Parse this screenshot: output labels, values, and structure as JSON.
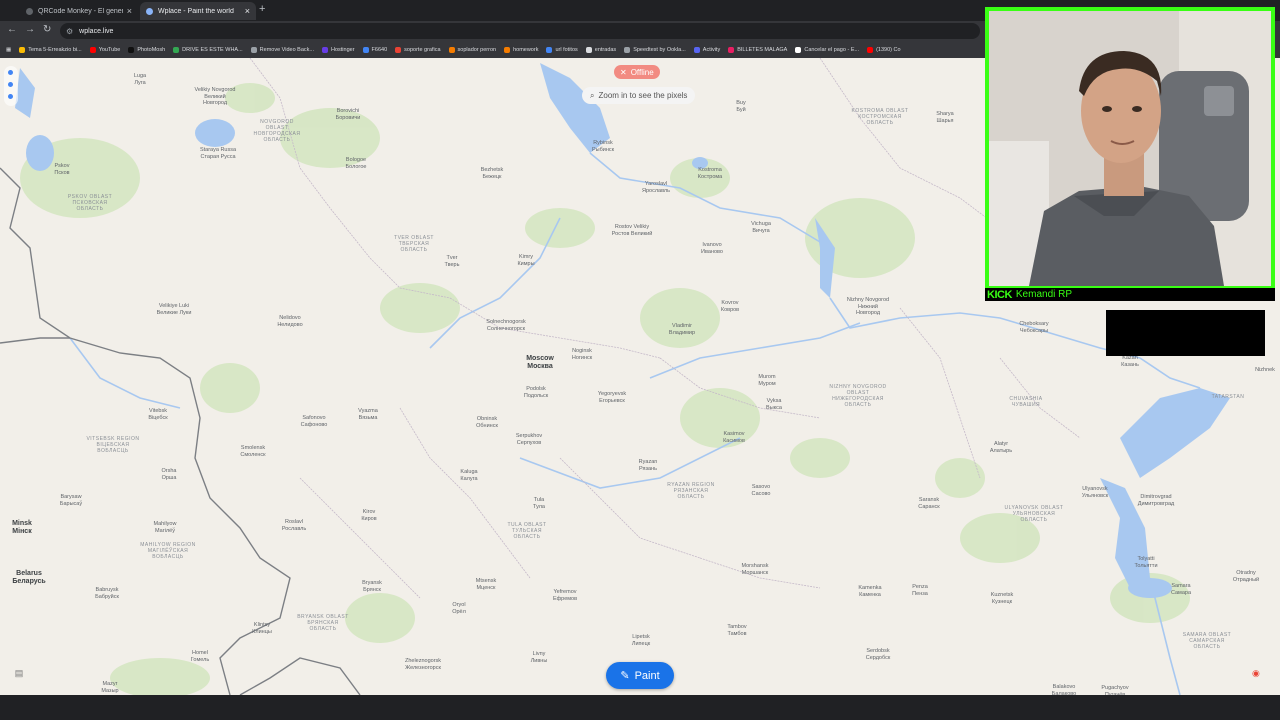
{
  "browser": {
    "tabs": [
      {
        "label": "QRCode Monkey - El generad...",
        "active": false
      },
      {
        "label": "Wplace - Paint the world",
        "active": true
      }
    ],
    "url": "wplace.live",
    "bookmarks": [
      "Tema 5-Erreakzio bi...",
      "YouTube",
      "PhotoMosh",
      "DRIVE ES ESTE WHA...",
      "Remove Video Back...",
      "Hostinger",
      "F6640",
      "soporte grafica",
      "soplador perron",
      "homework",
      "url fotitos",
      "entradas",
      "Speedtest by Ookla...",
      "Activity",
      "BILLETES MALAGA",
      "Cancelar el pago - E...",
      "(1390) Co"
    ]
  },
  "map": {
    "status_badge": "Offline",
    "zoom_hint": "Zoom in to see the pixels",
    "paint_button": "Paint",
    "cities": {
      "luga": "Luga\nЛуга",
      "velikiy_novgorod": "Velikiy Novgorod\nВеликий\nНовгород",
      "borovichi": "Borovichi\nБоровичи",
      "pskov": "Pskov\nПсков",
      "staraya_russa": "Staraya Russa\nСтарая Русса",
      "bologoe": "Bologoe\nБологое",
      "bezhetsk": "Bezhetsk\nБежецк",
      "rybinsk": "Rybinsk\nРыбинск",
      "buy": "Buy\nБуй",
      "sharya": "Sharya\nШарья",
      "yaroslavl": "Yaroslavl\nЯрославль",
      "kostroma": "Kostroma\nКострома",
      "rostov": "Rostov Velikiy\nРостов Великий",
      "vichuga": "Vichuga\nВичуга",
      "ivanovo": "Ivanovo\nИваново",
      "tver": "Tver\nТверь",
      "kimry": "Kimry\nКимры",
      "velikiye_luki": "Velikiye Luki\nВеликие Луки",
      "nelidovo": "Nelidovo\nНелидово",
      "solnechnogorsk": "Solnechnogorsk\nСолнечногорск",
      "kovrov": "Kovrov\nКовров",
      "nizhny": "Nizhny Novgorod\nНижний\nНовгород",
      "cheboksary": "Cheboksary\nЧебоксары",
      "vladimir": "Vladimir\nВладимир",
      "noginsk": "Noginsk\nНогинск",
      "moscow": "Moscow\nМосква",
      "kazan": "Kazan\nКазань",
      "nizhnek": "Nizhnek",
      "murom": "Murom\nМуром",
      "podolsk": "Podolsk\nПодольск",
      "yegoryevsk": "Yegoryevsk\nЕгорьевск",
      "vyksa": "Vyksa\nВыкса",
      "vitebsk": "Vitebsk\nВiцебск",
      "safonovo": "Safonovo\nСафоново",
      "vyazma": "Vyazma\nВязьма",
      "obninsk": "Obninsk\nОбнинск",
      "smolensk": "Smolensk\nСмоленск",
      "serpukhov": "Serpukhov\nСерпухов",
      "kasimov": "Kasimov\nКасимов",
      "alatyr": "Alatyr\nАлатырь",
      "orsha": "Orsha\nОрша",
      "ryazan": "Ryazan\nРязань",
      "kaluga": "Kaluga\nКалуга",
      "sasovo": "Sasovo\nСасово",
      "ulyanovsk": "Ulyanovsk\nУльяновск",
      "barysaw": "Barysaw\nБарысаў",
      "tula": "Tula\nТула",
      "dimitrovgrad": "Dimitrovgrad\nДимитровград",
      "saransk": "Saransk\nСаранск",
      "minsk": "Minsk\nМінск",
      "mahilyow": "Mahilyow\nМагілёў",
      "kirov": "Kirov\nКиров",
      "roslavl": "Roslavl\nРославль",
      "tolyatti": "Tolyatti\nТольятти",
      "belarus": "Belarus\nБеларусь",
      "morshansk": "Morshansk\nМоршанск",
      "otradny": "Otradny\nОтрадный",
      "bryansk": "Bryansk\nБрянск",
      "mtsensk": "Mtsensk\nМценск",
      "yefremov": "Yefremov\nЕфремов",
      "kamenka": "Kamenka\nКаменка",
      "penza": "Penza\nПенза",
      "kuznetsk": "Kuznetsk\nКузнецк",
      "samara": "Samara\nСамара",
      "babruysk": "Babruysk\nБабруйск",
      "oryol": "Oryol\nОрёл",
      "klintsy": "Klintsy\nКлинцы",
      "tambov": "Tambov\nТамбов",
      "lipetsk": "Lipetsk\nЛипецк",
      "homel": "Homel\nГомель",
      "serdobsk": "Serdobsk\nСердобск",
      "livny": "Livny\nЛивны",
      "zheleznogorsk": "Zheleznogorsk\nЖелезногорск",
      "mazyr": "Mazyr\nМазыр",
      "balakovo": "Balakovo\nБалаково",
      "pugachyov": "Pugachyov\nПугачёв"
    },
    "regions": {
      "kostroma": "KOSTROMA OBLAST\nКОСТРОМСКАЯ\nОБЛАСТЬ",
      "novgorod": "NOVGOROD\nOBLAST\nНОВГОРОДСКАЯ\nОБЛАСТЬ",
      "pskov": "PSKOV OBLAST\nПСКОВСКАЯ\nОБЛАСТЬ",
      "tver": "TVER OBLAST\nТВЕРСКАЯ\nОБЛАСТЬ",
      "nizhny": "NIZHNY NOVGOROD\nOBLAST\nНИЖЕГОРОДСКАЯ\nОБЛАСТЬ",
      "chuvashia": "CHUVASHIA\nЧУВАШИЯ",
      "tatarstan": "TATARSTAN",
      "vitsebsk": "VITSEBSK REGION\nВІЦЕБСКАЯ\nВОБЛАСЦЬ",
      "ryazan": "RYAZAN REGION\nРЯЗАНСКАЯ\nОБЛАСТЬ",
      "tula": "TULA OBLAST\nТУЛЬСКАЯ\nОБЛАСТЬ",
      "ulyanovsk": "ULYANOVSK OBLAST\nУЛЬЯНОВСКАЯ\nОБЛАСТЬ",
      "mahilyow": "MAHILYOW REGION\nМАГІЛЁЎСКАЯ\nВОБЛАСЦЬ",
      "bryansk": "BRYANSK OBLAST\nБРЯНСКАЯ\nОБЛАСТЬ",
      "samara": "SAMARA OBLAST\nСАМАРСКАЯ\nОБЛАСТЬ"
    }
  },
  "overlay": {
    "kick_logo": "KICK",
    "streamer_name": "Kemandi RP"
  },
  "colors": {
    "accent_green": "#39ff14",
    "paint_blue": "#1a73e8",
    "offline_red": "#f28b82",
    "water": "#a8c8f0",
    "forest": "#cfe3b9"
  }
}
